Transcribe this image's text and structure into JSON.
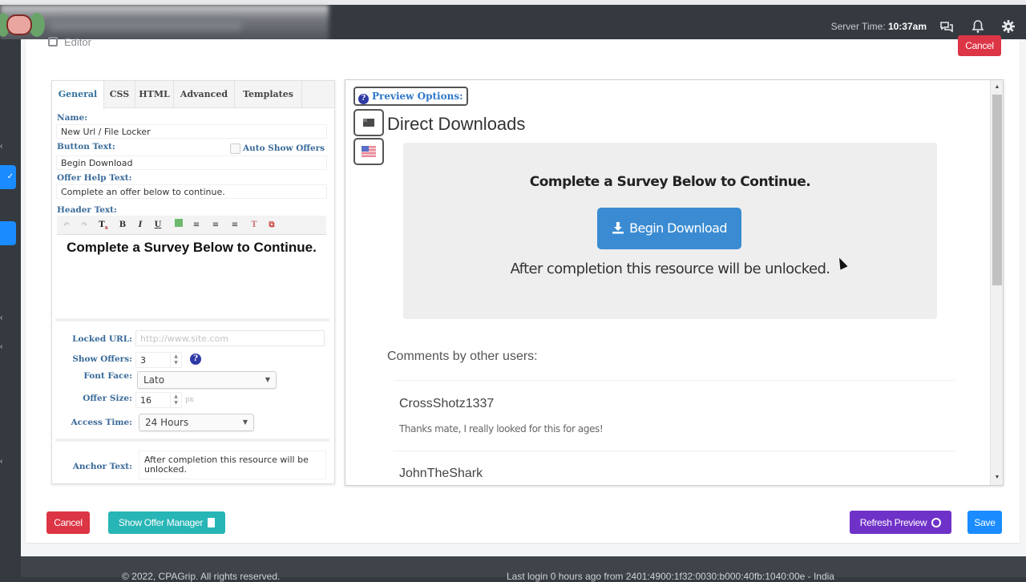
{
  "topbar": {
    "server_time_label": "Server Time:",
    "server_time_value": "10:37am",
    "icons": [
      "chat-icon",
      "bell-icon",
      "gear-icon"
    ]
  },
  "page": {
    "title": "Editor",
    "cancel_top": "Cancel"
  },
  "editor": {
    "tabs": [
      "General",
      "CSS",
      "HTML",
      "Advanced",
      "Templates"
    ],
    "active_tab": "General",
    "name_label": "Name:",
    "name_value": "New Url / File Locker",
    "button_text_label": "Button Text:",
    "auto_show_offers_label": "Auto Show Offers",
    "auto_show_offers_checked": false,
    "button_text_value": "Begin Download",
    "offer_help_label": "Offer Help Text:",
    "offer_help_value": "Complete an offer below to continue.",
    "header_text_label": "Header Text:",
    "toolbar": [
      "undo",
      "redo",
      "text-format",
      "B",
      "I",
      "U",
      "color",
      "align-left",
      "align-center",
      "align-right",
      "clear-format",
      "source"
    ],
    "header_text_value": "Complete a Survey Below to Continue.",
    "locked_url_label": "Locked URL:",
    "locked_url_placeholder": "http://www.site.com",
    "show_offers_label": "Show Offers:",
    "show_offers_value": "3",
    "font_face_label": "Font Face:",
    "font_face_value": "Lato",
    "offer_size_label": "Offer Size:",
    "offer_size_value": "16",
    "offer_size_unit": "px",
    "access_time_label": "Access Time:",
    "access_time_value": "24 Hours",
    "anchor_text_label": "Anchor Text:",
    "anchor_text_value": "After completion this resource will be unlocked."
  },
  "preview": {
    "options_label": "Preview Options:",
    "title": "Direct Downloads",
    "locker_header": "Complete a Survey Below to Continue.",
    "button_label": "Begin Download",
    "anchor_text": "After completion this resource will be unlocked.",
    "comments_heading": "Comments by other users:",
    "comments": [
      {
        "user": "CrossShotz1337",
        "text": "Thanks mate, I really looked for this for ages!"
      },
      {
        "user": "JohnTheShark",
        "text": ""
      }
    ]
  },
  "actions": {
    "cancel": "Cancel",
    "show_offer_manager": "Show Offer Manager",
    "refresh_preview": "Refresh Preview",
    "save": "Save"
  },
  "colors": {
    "danger": "#dc3545",
    "teal": "#28b5b5",
    "purple": "#6f32c8",
    "primary": "#1a8cff",
    "download_button": "#3a8bd2"
  },
  "footer": {
    "copyright": "© 2022, CPAGrip. All rights reserved.",
    "last_login": "Last login 0 hours ago from 2401:4900:1f32:0030:b000:40fb:1040:00e - India"
  }
}
